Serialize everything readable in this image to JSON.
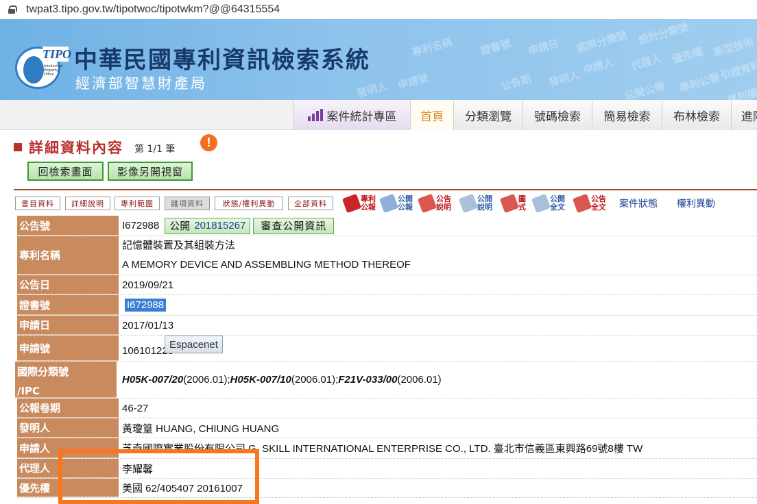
{
  "browser": {
    "url": "twpat3.tipo.gov.tw/tipotwoc/tipotwkm?@@64315554"
  },
  "banner": {
    "title": "中華民國專利資訊檢索系統",
    "subtitle": "經濟部智慧財產局",
    "logo_text": "TIPO",
    "logo_small": "Intellectual Property Office",
    "watermark_words": [
      "申請日",
      "國際分類號",
      "設計分類號",
      "專利名稱",
      "證書號",
      "申請人",
      "代理人",
      "優先權",
      "新型技術",
      "引證資料",
      "專利公報",
      "專利權人",
      "申請號",
      "發明人",
      "公開公報",
      "公告期"
    ]
  },
  "nav": {
    "tabs": [
      {
        "label": "案件統計專區",
        "active": false
      },
      {
        "label": "首頁",
        "active": true
      },
      {
        "label": "分類瀏覽",
        "active": false
      },
      {
        "label": "號碼檢索",
        "active": false
      },
      {
        "label": "簡易檢索",
        "active": false
      },
      {
        "label": "布林檢索",
        "active": false
      },
      {
        "label": "進階",
        "active": false
      }
    ]
  },
  "page": {
    "title": "詳細資料內容",
    "count": "第 1/1 筆",
    "back_button": "回檢索畫面",
    "image_window_button": "影像另開視窗"
  },
  "subtabs": [
    {
      "label": "書目資料",
      "disabled": false
    },
    {
      "label": "詳細說明",
      "disabled": false
    },
    {
      "label": "專利範圍",
      "disabled": false
    },
    {
      "label": "雜項資料",
      "disabled": true
    },
    {
      "label": "狀態/權利異動",
      "disabled": false
    },
    {
      "label": "全部資料",
      "disabled": false
    }
  ],
  "doc_icons": [
    {
      "label": "專利公報",
      "color": "#c0171b",
      "icon": "book-red-icon"
    },
    {
      "label": "公開公報",
      "color": "#2f5fa8",
      "icon": "book-blue-icon"
    },
    {
      "label": "公告說明",
      "color": "#c0171b",
      "icon": "doc-red-icon"
    },
    {
      "label": "公開說明",
      "color": "#2f5fa8",
      "icon": "doc-blue-icon"
    },
    {
      "label": "圖式",
      "color": "#c0171b",
      "icon": "drawing-red-icon"
    },
    {
      "label": "公開全文",
      "color": "#2f5fa8",
      "icon": "fulltext-blue-icon"
    },
    {
      "label": "公告全文",
      "color": "#c0171b",
      "icon": "fulltext-red-icon"
    }
  ],
  "text_links": {
    "case_status": "案件狀態",
    "rights_change": "權利異動"
  },
  "record": {
    "announce_no_label": "公告號",
    "announce_no": "I672988",
    "pub_button": "公開",
    "pub_no": "201815267",
    "review_button": "審查公開資訊",
    "title_label": "專利名稱",
    "title_zh": "記憶體裝置及其組裝方法",
    "title_en": "A MEMORY DEVICE AND ASSEMBLING METHOD THEREOF",
    "announce_date_label": "公告日",
    "announce_date": "2019/09/21",
    "cert_label": "證書號",
    "cert_no": "I672988",
    "app_date_label": "申請日",
    "app_date": "2017/01/13",
    "app_no_label": "申請號",
    "app_no": "106101228",
    "espacenet": "Espacenet",
    "ipc_label_1": "國際分類號",
    "ipc_label_2": "/IPC",
    "ipc": [
      {
        "code": "H05K-007/20",
        "ver": "(2006.01);"
      },
      {
        "code": "H05K-007/10",
        "ver": "(2006.01);"
      },
      {
        "code": "F21V-033/00",
        "ver": "(2006.01)"
      }
    ],
    "gazette_label": "公報卷期",
    "gazette": "46-27",
    "inventor_label": "發明人",
    "inventor": "黃瓊篁 HUANG, CHIUNG HUANG",
    "applicant_label": "申請人",
    "applicant": "芝奇國際實業股份有限公司 G. SKILL INTERNATIONAL ENTERPRISE CO., LTD. 臺北市信義區東興路69號8樓 TW",
    "agent_label": "代理人",
    "agent": "李耀馨",
    "priority_label": "優先權",
    "priority": "美國 62/405407 20161007"
  }
}
